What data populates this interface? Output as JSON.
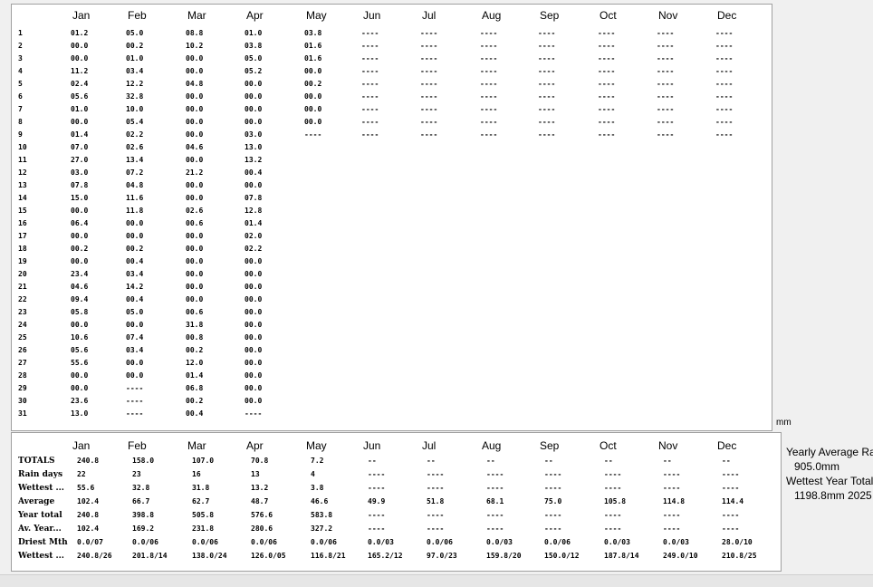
{
  "months": [
    "Jan",
    "Feb",
    "Mar",
    "Apr",
    "May",
    "Jun",
    "Jul",
    "Aug",
    "Sep",
    "Oct",
    "Nov",
    "Dec"
  ],
  "days": [
    "1",
    "2",
    "3",
    "4",
    "5",
    "6",
    "7",
    "8",
    "9",
    "10",
    "11",
    "12",
    "13",
    "14",
    "15",
    "16",
    "17",
    "18",
    "19",
    "20",
    "21",
    "22",
    "23",
    "24",
    "25",
    "26",
    "27",
    "28",
    "29",
    "30",
    "31"
  ],
  "daily": [
    [
      "01.2",
      "00.0",
      "00.0",
      "11.2",
      "02.4",
      "05.6",
      "01.0",
      "00.0",
      "01.4",
      "07.0",
      "27.0",
      "03.0",
      "07.8",
      "15.0",
      "00.0",
      "06.4",
      "00.0",
      "00.2",
      "00.0",
      "23.4",
      "04.6",
      "09.4",
      "05.8",
      "00.0",
      "10.6",
      "05.6",
      "55.6",
      "00.0",
      "00.0",
      "23.6",
      "13.0"
    ],
    [
      "05.0",
      "00.2",
      "01.0",
      "03.4",
      "12.2",
      "32.8",
      "10.0",
      "05.4",
      "02.2",
      "02.6",
      "13.4",
      "07.2",
      "04.8",
      "11.6",
      "11.8",
      "00.0",
      "00.0",
      "00.2",
      "00.4",
      "03.4",
      "14.2",
      "00.4",
      "05.0",
      "00.0",
      "07.4",
      "03.4",
      "00.0",
      "00.0",
      "----",
      "----",
      "----"
    ],
    [
      "08.8",
      "10.2",
      "00.0",
      "00.0",
      "04.8",
      "00.0",
      "00.0",
      "00.0",
      "00.0",
      "04.6",
      "00.0",
      "21.2",
      "00.0",
      "00.0",
      "02.6",
      "00.6",
      "00.0",
      "00.0",
      "00.0",
      "00.0",
      "00.0",
      "00.0",
      "00.6",
      "31.8",
      "00.8",
      "00.2",
      "12.0",
      "01.4",
      "06.8",
      "00.2",
      "00.4"
    ],
    [
      "01.0",
      "03.8",
      "05.0",
      "05.2",
      "00.0",
      "00.0",
      "00.0",
      "00.0",
      "03.0",
      "13.0",
      "13.2",
      "00.4",
      "00.0",
      "07.8",
      "12.8",
      "01.4",
      "02.0",
      "02.2",
      "00.0",
      "00.0",
      "00.0",
      "00.0",
      "00.0",
      "00.0",
      "00.0",
      "00.0",
      "00.0",
      "00.0",
      "00.0",
      "00.0",
      "----"
    ],
    [
      "03.8",
      "01.6",
      "01.6",
      "00.0",
      "00.2",
      "00.0",
      "00.0",
      "00.0",
      "----"
    ],
    [
      "----",
      "----",
      "----",
      "----",
      "----",
      "----",
      "----",
      "----",
      "----"
    ],
    [
      "----",
      "----",
      "----",
      "----",
      "----",
      "----",
      "----",
      "----",
      "----"
    ],
    [
      "----",
      "----",
      "----",
      "----",
      "----",
      "----",
      "----",
      "----",
      "----"
    ],
    [
      "----",
      "----",
      "----",
      "----",
      "----",
      "----",
      "----",
      "----",
      "----"
    ],
    [
      "----",
      "----",
      "----",
      "----",
      "----",
      "----",
      "----",
      "----",
      "----"
    ],
    [
      "----",
      "----",
      "----",
      "----",
      "----",
      "----",
      "----",
      "----",
      "----"
    ],
    [
      "----",
      "----",
      "----",
      "----",
      "----",
      "----",
      "----",
      "----",
      "----"
    ]
  ],
  "unit_label": "mm",
  "summary": {
    "labels": [
      "TOTALS",
      "Rain days",
      "Wettest ...",
      "Average",
      "Year total",
      "Av. Year...",
      "Driest Mth",
      "Wettest ..."
    ],
    "rows": [
      [
        "240.8",
        "158.0",
        "107.0",
        "70.8",
        "7.2",
        "--",
        "--",
        "--",
        "--",
        "--",
        "--",
        "--"
      ],
      [
        "22",
        "23",
        "16",
        "13",
        "4",
        "----",
        "----",
        "----",
        "----",
        "----",
        "----",
        "----"
      ],
      [
        "55.6",
        "32.8",
        "31.8",
        "13.2",
        "3.8",
        "----",
        "----",
        "----",
        "----",
        "----",
        "----",
        "----"
      ],
      [
        "102.4",
        "66.7",
        "62.7",
        "48.7",
        "46.6",
        "49.9",
        "51.8",
        "68.1",
        "75.0",
        "105.8",
        "114.8",
        "114.4"
      ],
      [
        "240.8",
        "398.8",
        "505.8",
        "576.6",
        "583.8",
        "----",
        "----",
        "----",
        "----",
        "----",
        "----",
        "----"
      ],
      [
        "102.4",
        "169.2",
        "231.8",
        "280.6",
        "327.2",
        "----",
        "----",
        "----",
        "----",
        "----",
        "----",
        "----"
      ],
      [
        "0.0/07",
        "0.0/06",
        "0.0/06",
        "0.0/06",
        "0.0/06",
        "0.0/03",
        "0.0/06",
        "0.0/03",
        "0.0/06",
        "0.0/03",
        "0.0/03",
        "28.0/10"
      ],
      [
        "240.8/26",
        "201.8/14",
        "138.0/24",
        "126.0/05",
        "116.8/21",
        "165.2/12",
        "97.0/23",
        "159.8/20",
        "150.0/12",
        "187.8/14",
        "249.0/10",
        "210.8/25"
      ]
    ]
  },
  "side": {
    "yearly_average_label": "Yearly Average Rain",
    "yearly_average_value": "905.0mm",
    "wettest_year_label": "Wettest Year Total",
    "wettest_year_value": "1198.8mm",
    "wettest_year_year": "2025"
  }
}
